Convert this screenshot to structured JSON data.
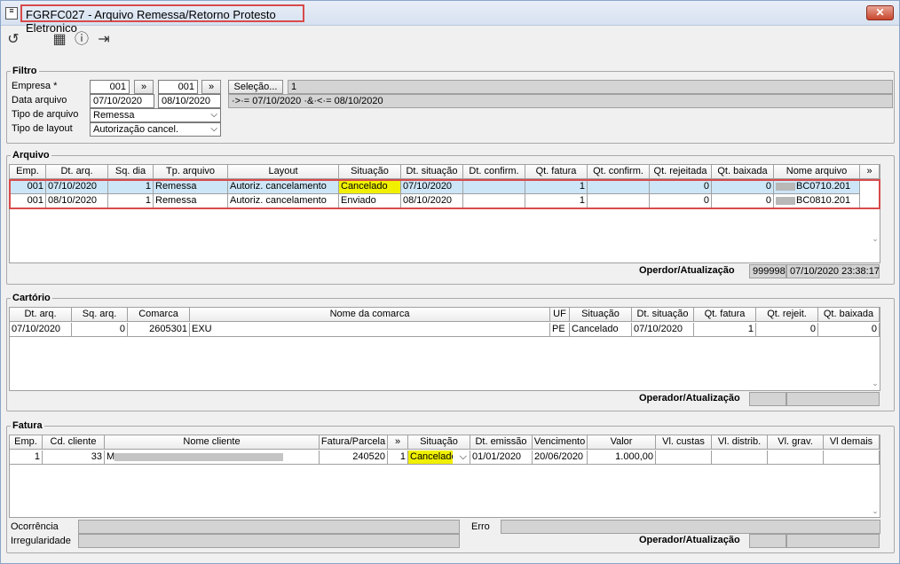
{
  "window": {
    "title": "FGRFC027 - Arquivo Remessa/Retorno Protesto Eletronico",
    "close_label": "✕"
  },
  "toolbar": {
    "icons": [
      "refresh-icon",
      "calendar-icon",
      "help-icon",
      "exit-icon"
    ]
  },
  "filtro": {
    "legend": "Filtro",
    "empresa_label": "Empresa *",
    "empresa_from": "001",
    "empresa_to": "001",
    "range_button": "»",
    "selecao_button": "Seleção...",
    "selecao_value": "1",
    "data_label": "Data arquivo",
    "data_from": "07/10/2020",
    "data_to": "08/10/2020",
    "data_expr": "·>·= 07/10/2020 ·&·<·= 08/10/2020",
    "tipo_arquivo_label": "Tipo de arquivo",
    "tipo_arquivo_value": "Remessa",
    "tipo_layout_label": "Tipo de layout",
    "tipo_layout_value": "Autorização cancel."
  },
  "arquivo": {
    "legend": "Arquivo",
    "columns": [
      "Emp.",
      "Dt. arq.",
      "Sq. dia",
      "Tp. arquivo",
      "Layout",
      "Situação",
      "Dt. situação",
      "Dt. confirm.",
      "Qt. fatura",
      "Qt. confirm.",
      "Qt. rejeitada",
      "Qt. baixada",
      "Nome arquivo",
      "»"
    ],
    "rows": [
      {
        "emp": "001",
        "dt_arq": "07/10/2020",
        "sq": "1",
        "tp": "Remessa",
        "layout": "Autoriz. cancelamento",
        "situacao": "Cancelado",
        "dt_sit": "07/10/2020",
        "dt_conf": "",
        "qt_fat": "1",
        "qt_conf": "",
        "qt_rej": "0",
        "qt_bai": "0",
        "nome": "BC0710.201"
      },
      {
        "emp": "001",
        "dt_arq": "08/10/2020",
        "sq": "1",
        "tp": "Remessa",
        "layout": "Autoriz. cancelamento",
        "situacao": "Enviado",
        "dt_sit": "08/10/2020",
        "dt_conf": "",
        "qt_fat": "1",
        "qt_conf": "",
        "qt_rej": "0",
        "qt_bai": "0",
        "nome": "BC0810.201"
      }
    ],
    "operador_label": "Operdor/Atualização",
    "operador_code": "999998",
    "operador_datetime": "07/10/2020 23:38:17"
  },
  "cartorio": {
    "legend": "Cartório",
    "columns": [
      "Dt. arq.",
      "Sq. arq.",
      "Comarca",
      "Nome da comarca",
      "UF",
      "Situação",
      "Dt. situação",
      "Qt. fatura",
      "Qt. rejeit.",
      "Qt. baixada"
    ],
    "rows": [
      {
        "dt_arq": "07/10/2020",
        "sq": "0",
        "comarca": "2605301",
        "nome": "EXU",
        "uf": "PE",
        "situacao": "Cancelado",
        "dt_sit": "07/10/2020",
        "qt_fat": "1",
        "qt_rej": "0",
        "qt_bai": "0"
      }
    ],
    "operador_label": "Operador/Atualização",
    "operador_code": "",
    "operador_datetime": ""
  },
  "fatura": {
    "legend": "Fatura",
    "columns": [
      "Emp.",
      "Cd. cliente",
      "Nome cliente",
      "Fatura/Parcela",
      "»",
      "Situação",
      "Dt. emissão",
      "Vencimento",
      "Valor",
      "Vl. custas",
      "Vl. distrib.",
      "Vl. grav.",
      "Vl demais"
    ],
    "rows": [
      {
        "emp": "1",
        "cd": "33",
        "nome_prefix": "M",
        "fatura": "240520",
        "parcela": "1",
        "situacao": "Cancelado",
        "emissao": "01/01/2020",
        "venc": "20/06/2020",
        "valor": "1.000,00",
        "custas": "",
        "distrib": "",
        "grav": "",
        "demais": ""
      }
    ],
    "ocorrencia_label": "Ocorrência",
    "ocorrencia_value": "",
    "irregularidade_label": "Irregularidade",
    "irregularidade_value": "",
    "erro_label": "Erro",
    "erro_value": "",
    "operador_label": "Operador/Atualização"
  }
}
